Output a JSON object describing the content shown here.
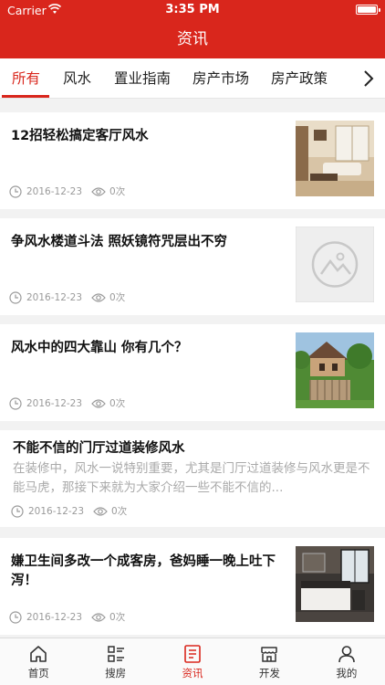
{
  "status_bar": {
    "carrier": "Carrier",
    "time": "3:35 PM"
  },
  "header": {
    "title": "资讯"
  },
  "tabs": [
    {
      "label": "所有",
      "active": true
    },
    {
      "label": "风水"
    },
    {
      "label": "置业指南"
    },
    {
      "label": "房产市场"
    },
    {
      "label": "房产政策"
    }
  ],
  "articles": [
    {
      "title": "12招轻松搞定客厅风水",
      "date": "2016-12-23",
      "views": "0次",
      "thumb": "living-room-photo"
    },
    {
      "title": "争风水楼道斗法 照妖镜符咒层出不穷",
      "date": "2016-12-23",
      "views": "0次",
      "thumb": "placeholder-image-icon"
    },
    {
      "title": "风水中的四大靠山 你有几个？",
      "date": "2016-12-23",
      "views": "0次",
      "thumb": "garden-house-photo"
    },
    {
      "title": "不能不信的门厅过道装修风水",
      "desc": "在装修中，风水一说特别重要，尤其是门厅过道装修与风水更是不能马虎，那接下来就为大家介绍一些不能不信的...",
      "date": "2016-12-23",
      "views": "0次"
    },
    {
      "title": "嫌卫生间多改一个成客房，爸妈睡一晚上吐下泻！",
      "date": "2016-12-23",
      "views": "0次",
      "thumb": "bedroom-photo"
    }
  ],
  "bottom_nav": [
    {
      "label": "首页",
      "icon": "home-icon"
    },
    {
      "label": "搜房",
      "icon": "list-icon"
    },
    {
      "label": "资讯",
      "icon": "news-icon",
      "active": true
    },
    {
      "label": "开发",
      "icon": "store-icon"
    },
    {
      "label": "我的",
      "icon": "user-icon"
    }
  ],
  "colors": {
    "brand": "#d9261c",
    "muted": "#9a9a9a"
  }
}
